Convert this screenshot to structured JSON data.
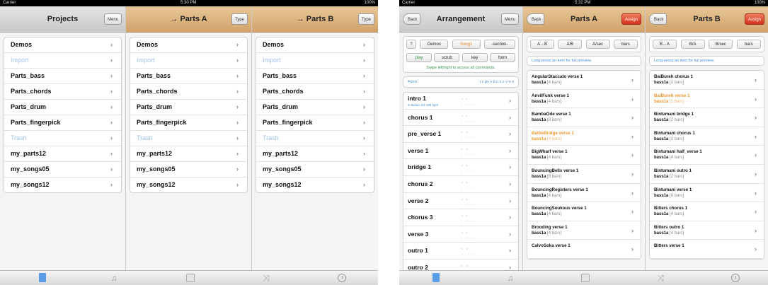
{
  "left": {
    "status": {
      "carrier": "Carrier",
      "time": "5:30 PM",
      "battery": "100%"
    },
    "projects": {
      "title": "Projects",
      "menu_label": "Menu",
      "items": [
        "Demos",
        "Import",
        "Parts_bass",
        "Parts_chords",
        "Parts_drum",
        "Parts_fingerpick",
        "Trash",
        "my_parts12",
        "my_songs05",
        "my_songs12"
      ]
    },
    "parts_a": {
      "title": "→ Parts A",
      "type_label": "Type",
      "items": [
        "Demos",
        "Import",
        "Parts_bass",
        "Parts_chords",
        "Parts_drum",
        "Parts_fingerpick",
        "Trash",
        "my_parts12",
        "my_songs05",
        "my_songs12"
      ]
    },
    "parts_b": {
      "title": "→ Parts B",
      "type_label": "Type",
      "items": [
        "Demos",
        "Import",
        "Parts_bass",
        "Parts_chords",
        "Parts_drum",
        "Parts_fingerpick",
        "Trash",
        "my_parts12",
        "my_songs05",
        "my_songs12"
      ]
    },
    "dim_items": [
      "Import",
      "Trash"
    ],
    "chevron": "›"
  },
  "right": {
    "status": {
      "carrier": "Carrier",
      "time": "5:32 PM",
      "battery": "100%"
    },
    "arrangement": {
      "title": "Arrangement",
      "back_label": "Back",
      "menu_label": "Menu",
      "top_buttons": [
        "?",
        "Demos",
        "Song1",
        "-section-"
      ],
      "action_buttons": [
        "play",
        "scrub",
        "key",
        "form"
      ],
      "hint": "Swipe left/right to access all commands.",
      "form_label": "Form:",
      "form_value": "i c pv v b c v c v o o",
      "sections": [
        {
          "name": "intro 1",
          "sub": "C dorian 4/4 100 bpm"
        },
        {
          "name": "chorus 1"
        },
        {
          "name": "pre_verse 1"
        },
        {
          "name": "verse 1"
        },
        {
          "name": "bridge 1"
        },
        {
          "name": "chorus 2"
        },
        {
          "name": "verse 2"
        },
        {
          "name": "chorus 3"
        },
        {
          "name": "verse 3"
        },
        {
          "name": "outro 1"
        },
        {
          "name": "outro 2"
        }
      ]
    },
    "parts_a": {
      "title": "Parts A",
      "back_label": "Back",
      "assign_label": "Assign",
      "buttons": [
        "A→B",
        "A/B",
        "A/sec",
        "bars"
      ],
      "hint": "Long-press an item for full preview.",
      "items": [
        {
          "title": "AngularStaccato verse 1",
          "inst": "bass1a",
          "bars": "[4 bars]"
        },
        {
          "title": "AnvilFunk verse 1",
          "inst": "bass1a",
          "bars": "[4 bars]"
        },
        {
          "title": "BambaOde verse 1",
          "inst": "bass1a",
          "bars": "[8 bars]"
        },
        {
          "title": "BattleBridge verse 1",
          "inst": "bass1a",
          "bars": "[4 bars]",
          "highlight": true
        },
        {
          "title": "BigWharf verse 1",
          "inst": "bass1a",
          "bars": "[4 bars]"
        },
        {
          "title": "BouncingBells verse 1",
          "inst": "bass1a",
          "bars": "[8 bars]"
        },
        {
          "title": "BouncingRegisters verse 1",
          "inst": "bass1a",
          "bars": "[4 bars]"
        },
        {
          "title": "BouncingSoukous verse 1",
          "inst": "bass1a",
          "bars": "[4 bars]"
        },
        {
          "title": "Brooding verse 1",
          "inst": "bass1a",
          "bars": "[4 bars]"
        },
        {
          "title": "CalvoSoka verse 1",
          "inst": "",
          "bars": ""
        }
      ]
    },
    "parts_b": {
      "title": "Parts B",
      "back_label": "Back",
      "assign_label": "Assign",
      "buttons": [
        "B→A",
        "B/A",
        "B/sec",
        "bars"
      ],
      "hint": "Long-press an item for full preview.",
      "items": [
        {
          "title": "BaiBureh chorus 1",
          "inst": "bass1a",
          "bars": "[2 bars]"
        },
        {
          "title": "BaiBureh verse 1",
          "inst": "bass1a",
          "bars": "[2 bars]",
          "highlight": true
        },
        {
          "title": "Bintumani bridge 1",
          "inst": "bass1a",
          "bars": "[2 bars]"
        },
        {
          "title": "Bintumani chorus 1",
          "inst": "bass1a",
          "bars": "[2 bars]"
        },
        {
          "title": "Bintumani half_verse 1",
          "inst": "bass1a",
          "bars": "[4 bars]"
        },
        {
          "title": "Bintumani outro 1",
          "inst": "bass1a",
          "bars": "[2 bars]"
        },
        {
          "title": "Bintumani verse 1",
          "inst": "bass1a",
          "bars": "[8 bars]"
        },
        {
          "title": "Bitters chorus 1",
          "inst": "bass1a",
          "bars": "[4 bars]"
        },
        {
          "title": "Bitters outro 1",
          "inst": "bass1a",
          "bars": "[4 bars]"
        },
        {
          "title": "Bitters verse 1",
          "inst": "",
          "bars": ""
        }
      ]
    },
    "chevron": "›"
  },
  "tabbar_icons": [
    "document-icon",
    "music-note-icon",
    "album-icon",
    "shuffle-icon",
    "clock-icon"
  ],
  "colors": {
    "accent": "#4b8fe6",
    "header_tan": "#d9ab72",
    "highlight_orange": "#f0962e",
    "dim_blue": "#9ec2e8",
    "assign_red": "#d2341f"
  }
}
